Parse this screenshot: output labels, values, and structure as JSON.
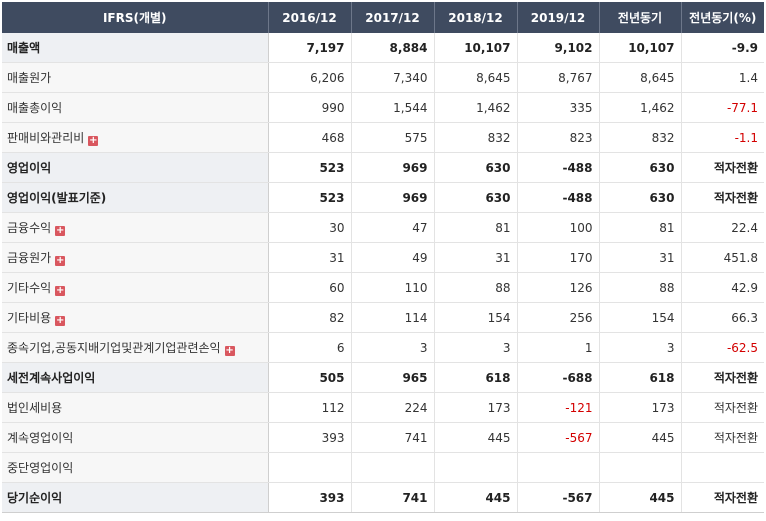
{
  "header": {
    "col0": "IFRS(개별)",
    "col1": "2016/12",
    "col2": "2017/12",
    "col3": "2018/12",
    "col4": "2019/12",
    "col5": "전년동기",
    "col6": "전년동기(%)"
  },
  "rows": [
    {
      "label": "매출액",
      "v": [
        "7,197",
        "8,884",
        "10,107",
        "9,102",
        "10,107",
        "-9.9"
      ]
    },
    {
      "label": "매출원가",
      "v": [
        "6,206",
        "7,340",
        "8,645",
        "8,767",
        "8,645",
        "1.4"
      ]
    },
    {
      "label": "매출총이익",
      "v": [
        "990",
        "1,544",
        "1,462",
        "335",
        "1,462",
        "-77.1"
      ]
    },
    {
      "label": "판매비와관리비",
      "v": [
        "468",
        "575",
        "832",
        "823",
        "832",
        "-1.1"
      ]
    },
    {
      "label": "영업이익",
      "v": [
        "523",
        "969",
        "630",
        "-488",
        "630",
        "적자전환"
      ]
    },
    {
      "label": "영업이익(발표기준)",
      "v": [
        "523",
        "969",
        "630",
        "-488",
        "630",
        "적자전환"
      ]
    },
    {
      "label": "금융수익",
      "v": [
        "30",
        "47",
        "81",
        "100",
        "81",
        "22.4"
      ]
    },
    {
      "label": "금융원가",
      "v": [
        "31",
        "49",
        "31",
        "170",
        "31",
        "451.8"
      ]
    },
    {
      "label": "기타수익",
      "v": [
        "60",
        "110",
        "88",
        "126",
        "88",
        "42.9"
      ]
    },
    {
      "label": "기타비용",
      "v": [
        "82",
        "114",
        "154",
        "256",
        "154",
        "66.3"
      ]
    },
    {
      "label": "종속기업,공동지배기업및관계기업관련손익",
      "v": [
        "6",
        "3",
        "3",
        "1",
        "3",
        "-62.5"
      ]
    },
    {
      "label": "세전계속사업이익",
      "v": [
        "505",
        "965",
        "618",
        "-688",
        "618",
        "적자전환"
      ]
    },
    {
      "label": "법인세비용",
      "v": [
        "112",
        "224",
        "173",
        "-121",
        "173",
        "적자전환"
      ]
    },
    {
      "label": "계속영업이익",
      "v": [
        "393",
        "741",
        "445",
        "-567",
        "445",
        "적자전환"
      ]
    },
    {
      "label": "중단영업이익",
      "v": [
        "",
        "",
        "",
        "",
        "",
        ""
      ]
    },
    {
      "label": "당기순이익",
      "v": [
        "393",
        "741",
        "445",
        "-567",
        "445",
        "적자전환"
      ]
    }
  ],
  "expand_icon": "plus-icon",
  "colors": {
    "header_bg": "#3f4b60",
    "negative": "#d30000",
    "expand": "#d9575f"
  }
}
